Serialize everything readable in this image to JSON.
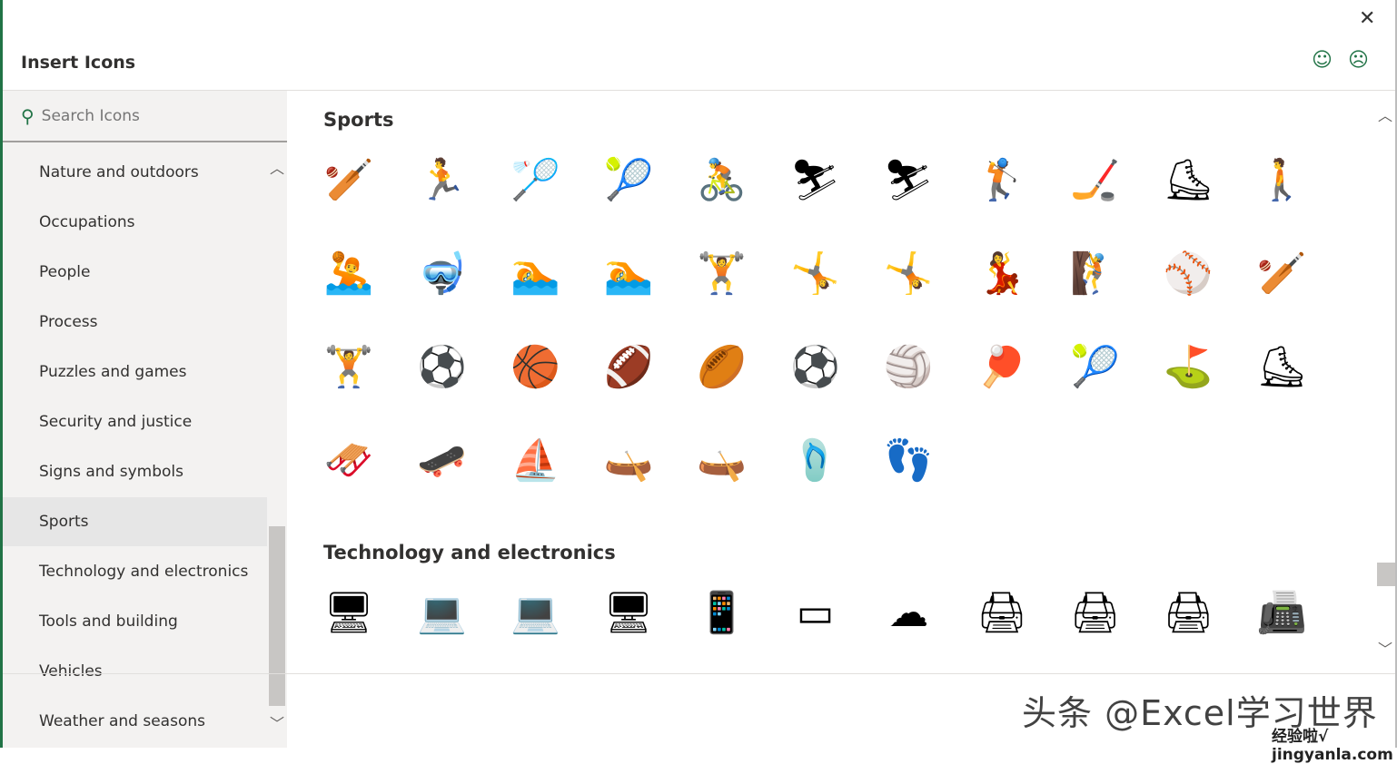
{
  "dialog": {
    "title": "Insert Icons",
    "close_icon": "close-icon",
    "smile_icon": "smiley-icon",
    "frown_icon": "frown-icon"
  },
  "search": {
    "placeholder": "Search Icons",
    "value": ""
  },
  "categories": [
    {
      "label": "Nature and outdoors"
    },
    {
      "label": "Occupations"
    },
    {
      "label": "People"
    },
    {
      "label": "Process"
    },
    {
      "label": "Puzzles and games"
    },
    {
      "label": "Security and justice"
    },
    {
      "label": "Signs and symbols"
    },
    {
      "label": "Sports",
      "selected": true
    },
    {
      "label": "Technology and electronics"
    },
    {
      "label": "Tools and building"
    },
    {
      "label": "Vehicles"
    },
    {
      "label": "Weather and seasons"
    }
  ],
  "sections": [
    {
      "title": "Sports",
      "icons": [
        {
          "name": "baseball-batter",
          "glyph": "🏏"
        },
        {
          "name": "soccer-player",
          "glyph": "🏃"
        },
        {
          "name": "badminton-player",
          "glyph": "🏸"
        },
        {
          "name": "tennis-player",
          "glyph": "🎾"
        },
        {
          "name": "cyclist",
          "glyph": "🚴"
        },
        {
          "name": "cross-country-skier",
          "glyph": "⛷"
        },
        {
          "name": "downhill-skier",
          "glyph": "⛷"
        },
        {
          "name": "golfer",
          "glyph": "🏌"
        },
        {
          "name": "hockey-player",
          "glyph": "🏒"
        },
        {
          "name": "speed-skater",
          "glyph": "⛸"
        },
        {
          "name": "snowshoer",
          "glyph": "🚶"
        },
        {
          "name": "water-polo",
          "glyph": "🤽"
        },
        {
          "name": "diver",
          "glyph": "🤿"
        },
        {
          "name": "swimming-pool",
          "glyph": "🏊"
        },
        {
          "name": "swimmer",
          "glyph": "🏊"
        },
        {
          "name": "weightlifter",
          "glyph": "🏋"
        },
        {
          "name": "gymnast-rings",
          "glyph": "🤸"
        },
        {
          "name": "rhythmic-gymnast",
          "glyph": "🤸"
        },
        {
          "name": "dancer",
          "glyph": "💃"
        },
        {
          "name": "rock-climber",
          "glyph": "🧗"
        },
        {
          "name": "baseball-bat",
          "glyph": "⚾"
        },
        {
          "name": "cricket-bat",
          "glyph": "🏏"
        },
        {
          "name": "dumbbell",
          "glyph": "🏋"
        },
        {
          "name": "sports-balls",
          "glyph": "⚽"
        },
        {
          "name": "basketball",
          "glyph": "🏀"
        },
        {
          "name": "football",
          "glyph": "🏈"
        },
        {
          "name": "rugby-ball",
          "glyph": "🏉"
        },
        {
          "name": "soccer-ball",
          "glyph": "⚽"
        },
        {
          "name": "volleyball",
          "glyph": "🏐"
        },
        {
          "name": "ping-pong",
          "glyph": "🏓"
        },
        {
          "name": "tennis-racket",
          "glyph": "🎾"
        },
        {
          "name": "golf-bag",
          "glyph": "⛳"
        },
        {
          "name": "ice-skate",
          "glyph": "⛸"
        },
        {
          "name": "sled",
          "glyph": "🛷"
        },
        {
          "name": "skateboard",
          "glyph": "🛹"
        },
        {
          "name": "sailboat",
          "glyph": "⛵"
        },
        {
          "name": "canoe",
          "glyph": "🛶"
        },
        {
          "name": "kayak",
          "glyph": "🛶"
        },
        {
          "name": "swim-fins",
          "glyph": "🩴"
        },
        {
          "name": "footprints",
          "glyph": "👣"
        }
      ]
    },
    {
      "title": "Technology and electronics",
      "icons": [
        {
          "name": "desktop-computer",
          "glyph": "🖥"
        },
        {
          "name": "laptop",
          "glyph": "💻"
        },
        {
          "name": "laptop-globe",
          "glyph": "💻"
        },
        {
          "name": "monitor",
          "glyph": "🖥"
        },
        {
          "name": "smartphone",
          "glyph": "📱"
        },
        {
          "name": "tablet",
          "glyph": "▭"
        },
        {
          "name": "cloud-computing",
          "glyph": "☁"
        },
        {
          "name": "printer",
          "glyph": "🖨"
        },
        {
          "name": "printer-2",
          "glyph": "🖨"
        },
        {
          "name": "shredder",
          "glyph": "🖨"
        },
        {
          "name": "fax",
          "glyph": "📠"
        }
      ]
    }
  ],
  "watermark": {
    "line1": "头条 @Excel学习世界",
    "line2": "经验啦√ jingyanla.com"
  }
}
